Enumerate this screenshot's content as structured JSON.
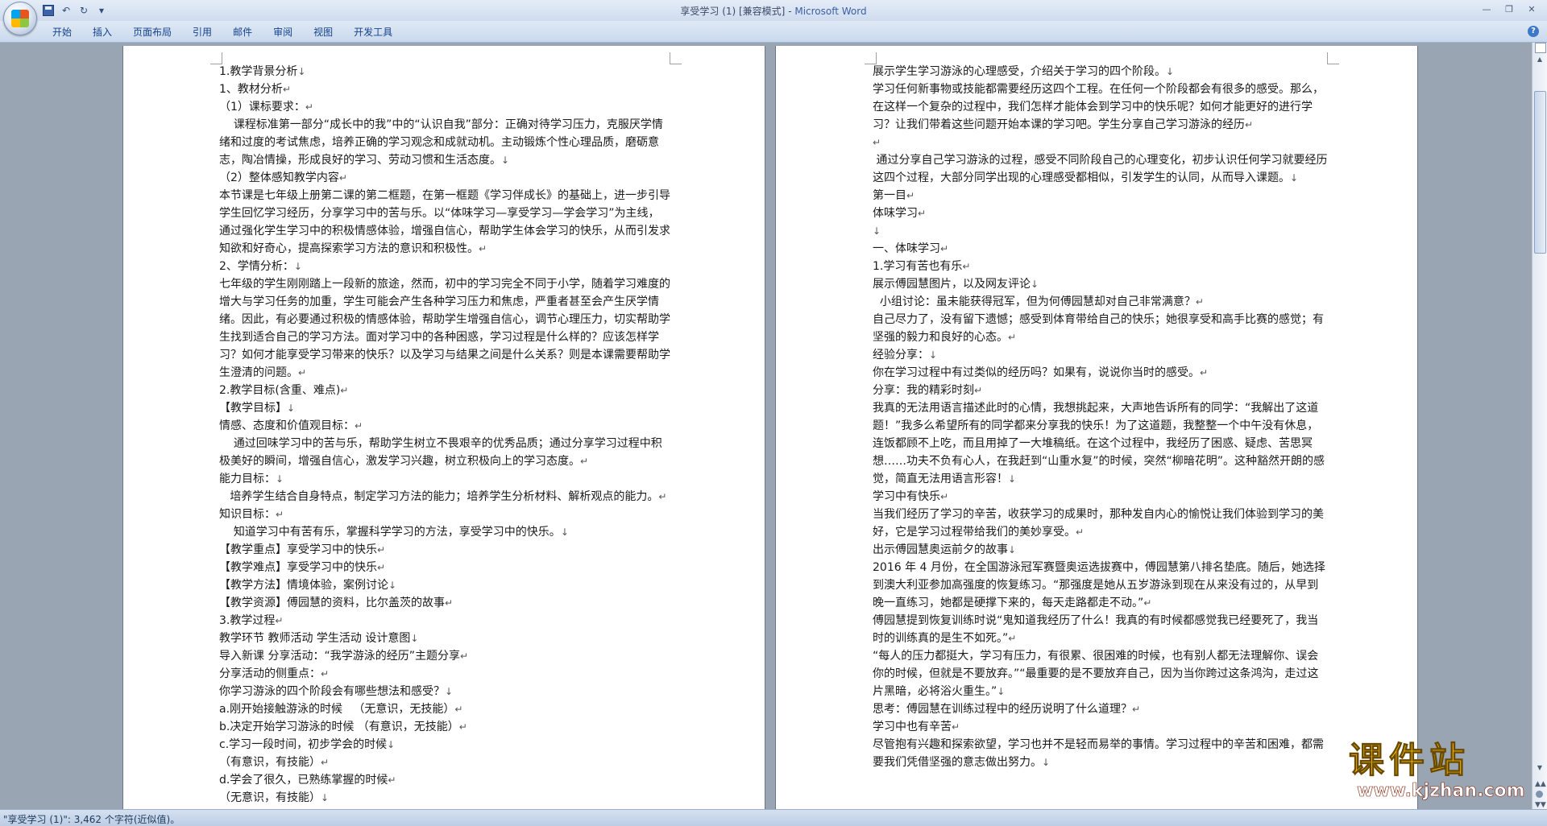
{
  "window": {
    "title_doc": "享受学习 (1) [兼容模式]",
    "title_sep": " - ",
    "title_app": "Microsoft Word"
  },
  "ribbon": {
    "tabs": [
      "开始",
      "插入",
      "页面布局",
      "引用",
      "邮件",
      "审阅",
      "视图",
      "开发工具"
    ]
  },
  "document": {
    "left_page": [
      "1.教学背景分析",
      "1、教材分析",
      "（1）课标要求：",
      "    课程标准第一部分“成长中的我”中的“认识自我”部分：正确对待学习压力，克服厌学情绪和过度的考试焦虑，培养正确的学习观念和成就动机。主动锻炼个性心理品质，磨砺意志，陶冶情操，形成良好的学习、劳动习惯和生活态度。",
      "（2）整体感知教学内容",
      "本节课是七年级上册第二课的第二框题，在第一框题《学习伴成长》的基础上，进一步引导学生回忆学习经历，分享学习中的苦与乐。以“体味学习—享受学习—学会学习”为主线，通过强化学生学习中的积极情感体验，增强自信心，帮助学生体会学习的快乐，从而引发求知欲和好奇心，提高探索学习方法的意识和积极性。",
      "2、学情分析：",
      "七年级的学生刚刚踏上一段新的旅途，然而，初中的学习完全不同于小学，随着学习难度的增大与学习任务的加重，学生可能会产生各种学习压力和焦虑，严重者甚至会产生厌学情绪。因此，有必要通过积极的情感体验，帮助学生增强自信心，调节心理压力，切实帮助学生找到适合自己的学习方法。面对学习中的各种困惑，学习过程是什么样的？应该怎样学习？如何才能享受学习带来的快乐？以及学习与结果之间是什么关系？则是本课需要帮助学生澄清的问题。",
      "2.教学目标(含重、难点)",
      "【教学目标】",
      "情感、态度和价值观目标：",
      "    通过回味学习中的苦与乐，帮助学生树立不畏艰辛的优秀品质；通过分享学习过程中积极美好的瞬间，增强自信心，激发学习兴趣，树立积极向上的学习态度。",
      "能力目标：",
      "   培养学生结合自身特点，制定学习方法的能力；培养学生分析材料、解析观点的能力。",
      "知识目标：",
      "    知道学习中有苦有乐，掌握科学学习的方法，享受学习中的快乐。",
      "【教学重点】享受学习中的快乐",
      "【教学难点】享受学习中的快乐",
      "【教学方法】情境体验，案例讨论",
      "【教学资源】傅园慧的资料，比尔盖茨的故事",
      "3.教学过程",
      "教学环节 教师活动 学生活动 设计意图",
      "导入新课 分享活动：“我学游泳的经历”主题分享",
      "分享活动的侧重点：",
      "你学习游泳的四个阶段会有哪些想法和感受？",
      "a.刚开始接触游泳的时候   （无意识，无技能）",
      "b.决定开始学习游泳的时候 （有意识，无技能）",
      "c.学习一段时间，初步学会的时候",
      "（有意识，有技能）",
      "d.学会了很久，已熟练掌握的时候",
      "（无意识，有技能）"
    ],
    "right_page": [
      "展示学生学习游泳的心理感受，介绍关于学习的四个阶段。",
      "学习任何新事物或技能都需要经历这四个工程。在任何一个阶段都会有很多的感受。那么，在这样一个复杂的过程中，我们怎样才能体会到学习中的快乐呢？如何才能更好的进行学习？让我们带着这些问题开始本课的学习吧。学生分享自己学习游泳的经历",
      "",
      " 通过分享自己学习游泳的过程，感受不同阶段自己的心理变化，初步认识任何学习就要经历这四个过程，大部分同学出现的心理感受都相似，引发学生的认同，从而导入课题。",
      "第一目",
      "体味学习",
      "",
      "一、体味学习",
      "1.学习有苦也有乐",
      "展示傅园慧图片，以及网友评论",
      "  小组讨论：虽未能获得冠军，但为何傅园慧却对自己非常满意？",
      "自己尽力了，没有留下遗憾；感受到体育带给自己的快乐；她很享受和高手比赛的感觉；有坚强的毅力和良好的心态。",
      "经验分享：",
      "你在学习过程中有过类似的经历吗？如果有，说说你当时的感受。",
      "分享：我的精彩时刻",
      "我真的无法用语言描述此时的心情，我想挑起来，大声地告诉所有的同学：“我解出了这道题！”我多么希望所有的同学都来分享我的快乐！为了这道题，我整整一个中午没有休息，连饭都顾不上吃，而且用掉了一大堆稿纸。在这个过程中，我经历了困惑、疑虑、苦思冥想……功夫不负有心人，在我赶到“山重水复”的时候，突然“柳暗花明”。这种豁然开朗的感觉，简直无法用语言形容！",
      "学习中有快乐",
      "当我们经历了学习的辛苦，收获学习的成果时，那种发自内心的愉悦让我们体验到学习的美好，它是学习过程带给我们的美妙享受。",
      "出示傅园慧奥运前夕的故事",
      "2016 年 4 月份，在全国游泳冠军赛暨奥运选拔赛中，傅园慧第八排名垫底。随后，她选择到澳大利亚参加高强度的恢复练习。“那强度是她从五岁游泳到现在从来没有过的，从早到晚一直练习，她都是硬撑下来的，每天走路都走不动。”",
      "傅园慧提到恢复训练时说“鬼知道我经历了什么！我真的有时候都感觉我已经要死了，我当时的训练真的是生不如死。”",
      "“每人的压力都挺大，学习有压力，有很累、很困难的时候，也有别人都无法理解你、误会你的时候，但就是不要放弃。”“最重要的是不要放弃自己，因为当你跨过这条鸿沟，走过这片黑暗，必将浴火重生。”",
      "思考：傅园慧在训练过程中的经历说明了什么道理？",
      "学习中也有辛苦",
      "尽管抱有兴趣和探索欲望，学习也并不是轻而易举的事情。学习过程中的辛苦和困难，都需要我们凭借坚强的意志做出努力。"
    ]
  },
  "statusbar": {
    "text": "\"享受学习 (1)\": 3,462 个字符(近似值)。"
  },
  "watermark": {
    "title": "课件站",
    "url": "www.kjzhan.com"
  },
  "icons": {
    "office_button": "office-logo-icon",
    "save": "save-icon",
    "undo": "undo-icon",
    "redo": "redo-icon",
    "customize": "dropdown-arrow-icon",
    "minimize": "minimize-icon",
    "restore": "restore-icon",
    "close": "close-icon",
    "help": "help-icon"
  }
}
